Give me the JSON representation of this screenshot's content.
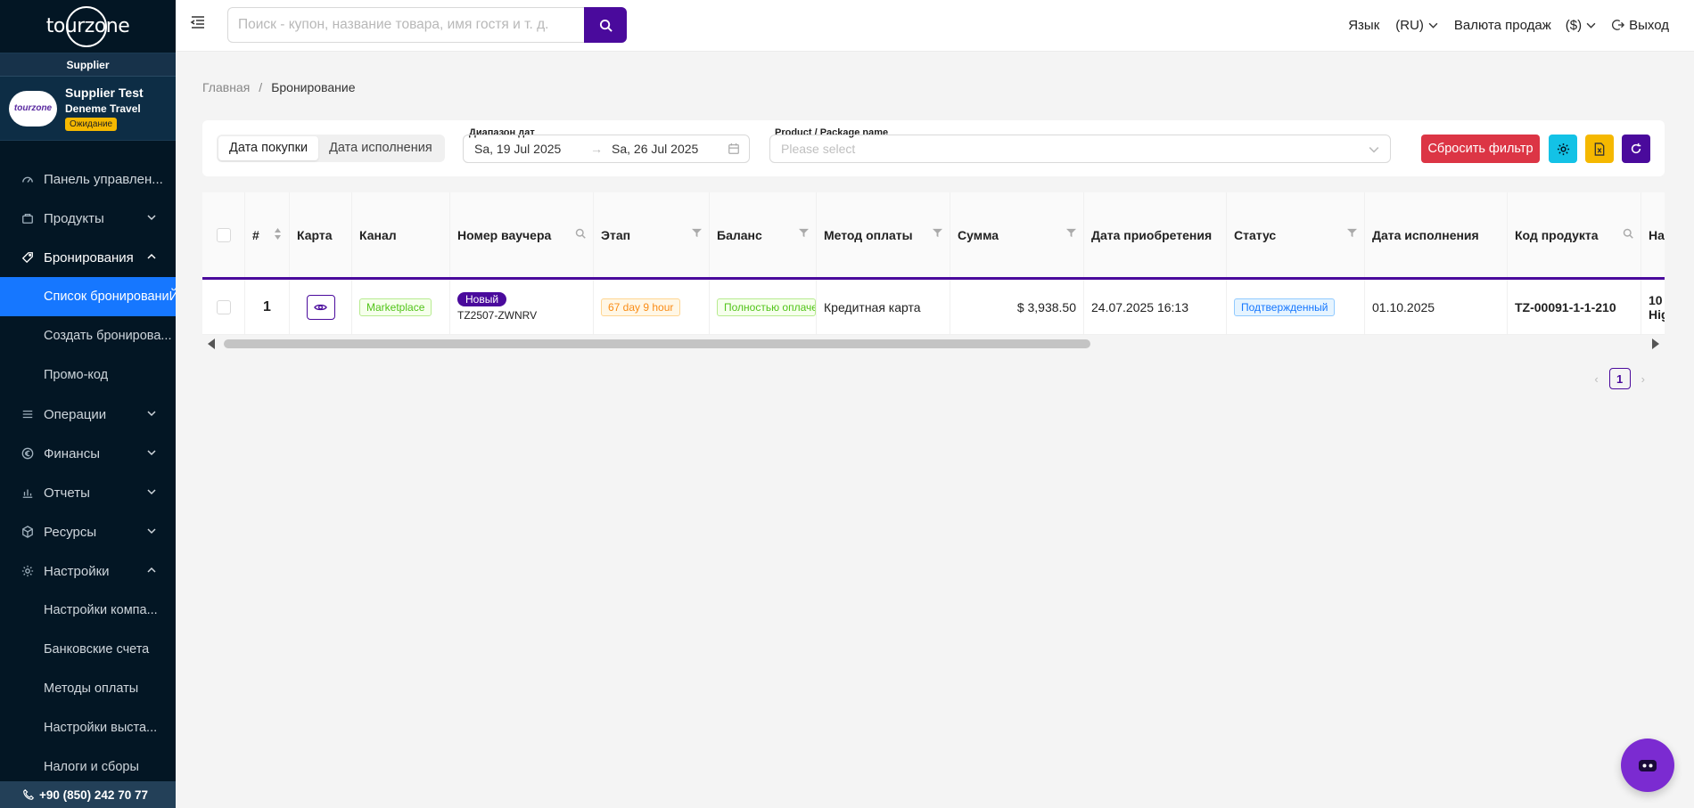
{
  "sidebar": {
    "logo": "tourzone",
    "role": "Supplier",
    "supplier": {
      "avatar_text": "tourzone",
      "name": "Supplier Test",
      "company": "Deneme Travel",
      "status": "Ожидание"
    },
    "items": [
      {
        "label": "Панель управлен..."
      },
      {
        "label": "Продукты"
      },
      {
        "label": "Бронирования"
      },
      {
        "label": "Операции"
      },
      {
        "label": "Финансы"
      },
      {
        "label": "Отчеты"
      },
      {
        "label": "Ресурсы"
      },
      {
        "label": "Настройки"
      }
    ],
    "booking_sub": [
      "Список бронированиЙ...",
      "Создать бронирова...",
      "Промо-код"
    ],
    "settings_sub": [
      "Настройки компа...",
      "Банковские счета",
      "Методы оплаты",
      "Настройки выста...",
      "Налоги и сборы"
    ],
    "phone": "+90 (850) 242 70 77"
  },
  "header": {
    "search_placeholder": "Поиск - купон, название товара, имя гостя и т. д.",
    "lang_label": "Язык",
    "lang_value": "(RU)",
    "currency_label": "Валюта продаж",
    "currency_value": "($)",
    "logout": "Выход"
  },
  "breadcrumb": {
    "home": "Главная",
    "separator": "/",
    "current": "Бронирование"
  },
  "filters": {
    "seg_purchase": "Дата покупки",
    "seg_execution": "Дата исполнения",
    "date_label": "Диапазон дат",
    "date_from": "Sa, 19 Jul 2025",
    "date_arrow": "→",
    "date_to": "Sa, 26 Jul 2025",
    "product_label": "Product / Package name",
    "product_placeholder": "Please select",
    "reset": "Сбросить фильтр",
    "colors": {
      "reset": "#dc3545",
      "settings": "#13c2e6",
      "export": "#f5b800",
      "refresh": "#4a0a9c"
    }
  },
  "table": {
    "headers": {
      "num": "#",
      "card": "Карта",
      "channel": "Канал",
      "voucher": "Номер ваучера",
      "stage": "Этап",
      "balance": "Баланс",
      "payment": "Метод оплаты",
      "amount": "Сумма",
      "purchase_date": "Дата приобретения",
      "status": "Статус",
      "exec_date": "Дата исполнения",
      "product_code": "Код продукта",
      "name": "На"
    },
    "rows": [
      {
        "num": "1",
        "channel": "Marketplace",
        "voucher_badge": "Новый",
        "voucher": "TZ2507-ZWNRV",
        "stage": "67 day 9 hour",
        "balance": "Полностью оплачен",
        "payment": "Кредитная карта",
        "amount": "$ 3,938.50",
        "purchase_date": "24.07.2025 16:13",
        "status": "Подтвержденный",
        "exec_date": "01.10.2025",
        "product_code": "TZ-00091-1-1-210",
        "name_line1": "10",
        "name_line2": "Hig"
      }
    ]
  },
  "pagination": {
    "current": "1",
    "prev": "‹",
    "next": "›"
  }
}
